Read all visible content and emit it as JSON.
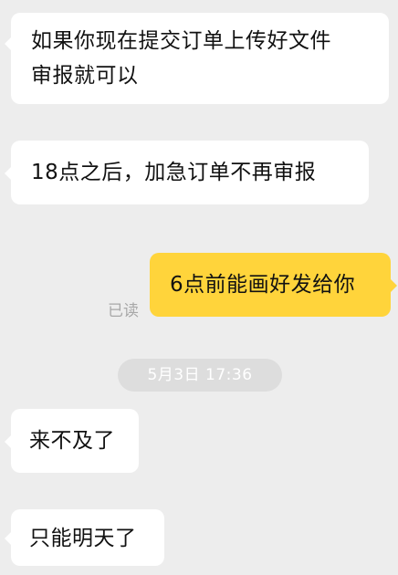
{
  "messages": [
    {
      "direction": "incoming",
      "lines": [
        "如果你现在提交订单上传好文件",
        "审报就可以"
      ]
    },
    {
      "direction": "incoming",
      "text": "18点之后，加急订单不再审报"
    },
    {
      "direction": "outgoing",
      "text": "6点前能画好发给你",
      "status": "已读"
    },
    {
      "direction": "incoming",
      "text": "来不及了"
    },
    {
      "direction": "incoming",
      "text": "只能明天了"
    }
  ],
  "timestamp": "5月3日 17:36",
  "colors": {
    "background": "#ededed",
    "incoming_bubble": "#ffffff",
    "outgoing_bubble": "#ffd43b",
    "timestamp_pill": "#dddddd",
    "read_status": "#a8a8a8"
  }
}
